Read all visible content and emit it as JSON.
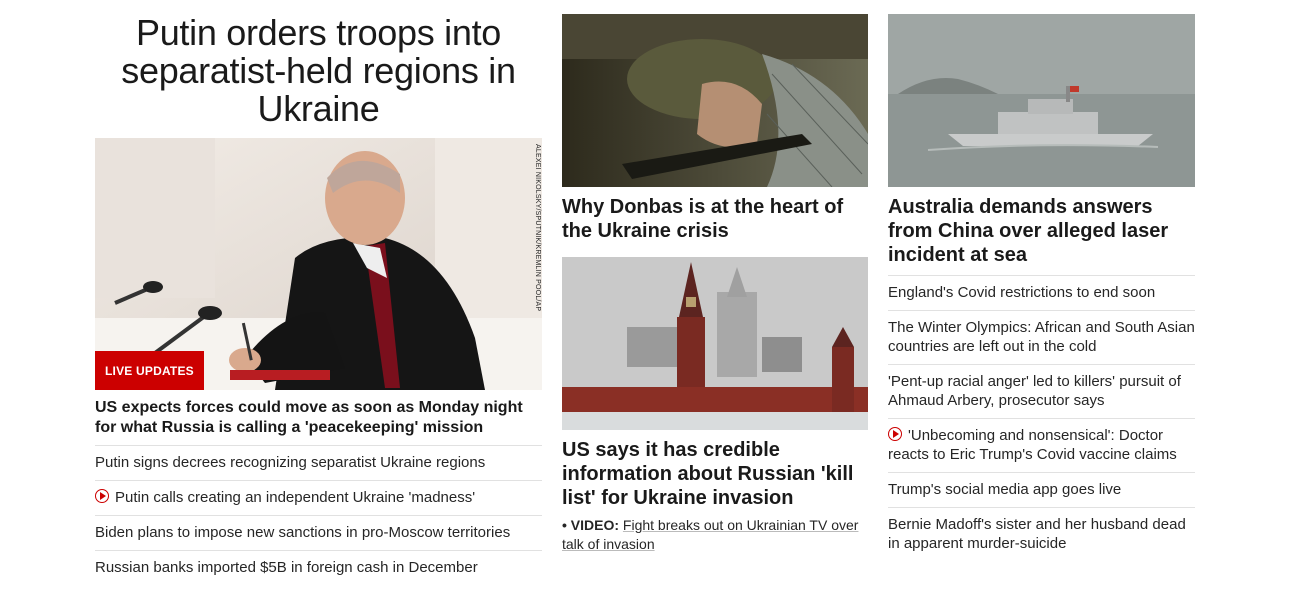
{
  "col1": {
    "headline": "Putin orders troops into separatist-held regions in Ukraine",
    "photo_credit": "ALEXEI NIKOLSKY/SPUTNIK/KREMLIN POOL/AP",
    "badge": "LIVE UPDATES",
    "lead": "US expects forces could move as soon as Monday night for what Russia is calling a 'peacekeeping' mission",
    "links": [
      {
        "text": "Putin signs decrees recognizing separatist Ukraine regions",
        "video": false
      },
      {
        "text": "Putin calls creating an independent Ukraine 'madness'",
        "video": true
      },
      {
        "text": "Biden plans to impose new sanctions in pro-Moscow territories",
        "video": false
      },
      {
        "text": "Russian banks imported $5B in foreign cash in December",
        "video": false
      }
    ]
  },
  "col2": {
    "card1": {
      "headline": "Why Donbas is at the heart of the Ukraine crisis"
    },
    "card2": {
      "headline": "US says it has credible information about Russian 'kill list' for Ukraine invasion",
      "video_prefix": "• VIDEO:",
      "video_text": "Fight breaks out on Ukrainian TV over talk of invasion"
    }
  },
  "col3": {
    "headline": "Australia demands answers from China over alleged laser incident at sea",
    "links": [
      {
        "text": "England's Covid restrictions to end soon",
        "video": false
      },
      {
        "text": "The Winter Olympics: African and South Asian countries are left out in the cold",
        "video": false
      },
      {
        "text": "'Pent-up racial anger' led to killers' pursuit of Ahmaud Arbery, prosecutor says",
        "video": false
      },
      {
        "text": "'Unbecoming and nonsensical': Doctor reacts to Eric Trump's Covid vaccine claims",
        "video": true
      },
      {
        "text": "Trump's social media app goes live",
        "video": false
      },
      {
        "text": "Bernie Madoff's sister and her husband dead in apparent murder-suicide",
        "video": false
      }
    ]
  },
  "colors": {
    "accent": "#cc0000",
    "text": "#0c0c0c",
    "divider": "#e1e1e1"
  },
  "icons": {
    "video": "play-circle-icon"
  }
}
